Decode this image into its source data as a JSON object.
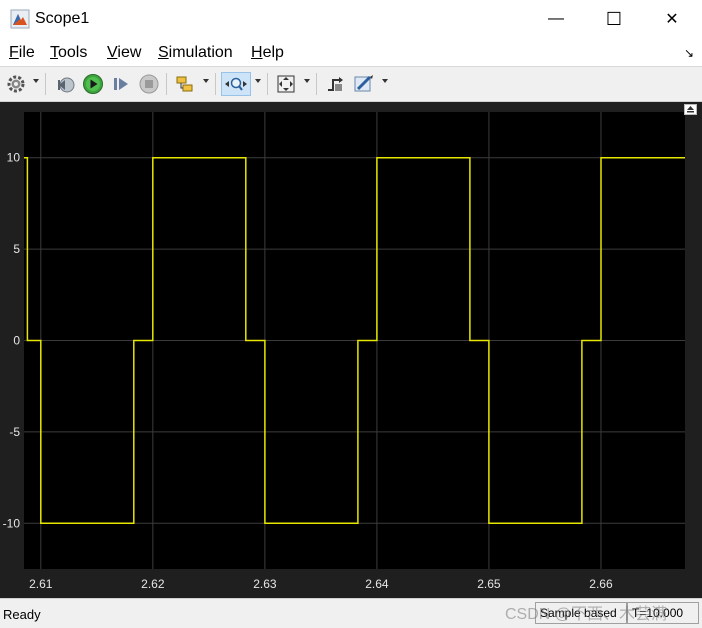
{
  "window": {
    "title": "Scope1",
    "minimize": "—",
    "maximize": "☐",
    "close": "✕"
  },
  "menu": {
    "items": [
      {
        "label": "File",
        "key": "F",
        "rest": "ile"
      },
      {
        "label": "Tools",
        "key": "T",
        "rest": "ools"
      },
      {
        "label": "View",
        "key": "V",
        "rest": "iew"
      },
      {
        "label": "Simulation",
        "key": "S",
        "rest": "imulation"
      },
      {
        "label": "Help",
        "key": "H",
        "rest": "elp"
      }
    ]
  },
  "toolbar": {
    "icons": [
      "gear-icon",
      "step-back-icon",
      "run-icon",
      "step-forward-icon",
      "stop-icon",
      "signal-select-icon",
      "zoom-x-icon",
      "fit-view-icon",
      "triggers-icon",
      "highlight-icon"
    ]
  },
  "chart_data": {
    "type": "line",
    "xlim": [
      2.6085,
      2.6675
    ],
    "ylim": [
      -12.5,
      12.5
    ],
    "xticks": [
      2.61,
      2.62,
      2.63,
      2.64,
      2.65,
      2.66
    ],
    "xtick_labels": [
      "2.61",
      "2.62",
      "2.63",
      "2.64",
      "2.65",
      "2.66"
    ],
    "yticks": [
      -10,
      -5,
      0,
      5,
      10
    ],
    "ytick_labels": [
      "-10",
      "-5",
      "0",
      "5",
      "10"
    ],
    "grid": true,
    "background": "#000000",
    "line_color": "#e6e600",
    "series": [
      {
        "x": [
          2.6085,
          2.6088,
          2.6088,
          2.61,
          2.61,
          2.6183,
          2.6183,
          2.62,
          2.62,
          2.6283,
          2.6283,
          2.63,
          2.63,
          2.6383,
          2.6383,
          2.64,
          2.64,
          2.6483,
          2.6483,
          2.65,
          2.65,
          2.6583,
          2.6583,
          2.66,
          2.66,
          2.6675
        ],
        "y": [
          10,
          10,
          0,
          0,
          -10,
          -10,
          0,
          0,
          10,
          10,
          0,
          0,
          -10,
          -10,
          0,
          0,
          10,
          10,
          0,
          0,
          -10,
          -10,
          0,
          0,
          10,
          10
        ]
      }
    ]
  },
  "status": {
    "ready": "Ready",
    "sample": "Sample based",
    "time": "T=10.000"
  },
  "watermark": "CSDN @不西、木芸满"
}
